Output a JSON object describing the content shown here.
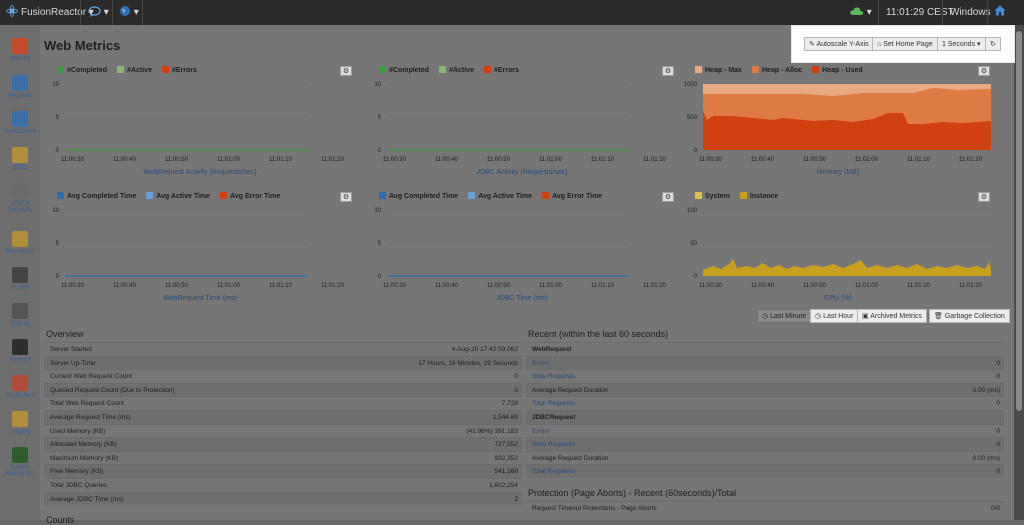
{
  "topbar": {
    "app": "FusionReactor",
    "time": "11:01:29 CEST",
    "os": "Windows"
  },
  "sidebar": [
    {
      "label": "Metrics",
      "icon": "chart-icon",
      "color": "#c64c2c"
    },
    {
      "label": "Requests",
      "icon": "requests-icon",
      "color": "#3d6fa8"
    },
    {
      "label": "Transactions",
      "icon": "transactions-icon",
      "color": "#3d6fa8"
    },
    {
      "label": "JDBC",
      "icon": "database-icon",
      "color": "#b18f3a"
    },
    {
      "label": "UEM & Sessions",
      "icon": "sessions-icon",
      "color": "#6b6b6b"
    },
    {
      "label": "Resources",
      "icon": "resources-icon",
      "color": "#b18f3a"
    },
    {
      "label": "Profiler",
      "icon": "stopwatch-icon",
      "color": "#444444"
    },
    {
      "label": "Debug",
      "icon": "debug-icon",
      "color": "#555555"
    },
    {
      "label": "Memory",
      "icon": "memory-icon",
      "color": "#2e2e2e"
    },
    {
      "label": "Protection",
      "icon": "shield-icon",
      "color": "#b24c3b"
    },
    {
      "label": "Logging",
      "icon": "logging-icon",
      "color": "#b18f3a"
    },
    {
      "label": "System Resources",
      "icon": "system-icon",
      "color": "#2e5d2e"
    }
  ],
  "page": {
    "title": "Web Metrics"
  },
  "toolbar": {
    "autoscale": "Autoscale Y-Axis",
    "home": "Set Home Page",
    "interval": "1 Seconds"
  },
  "charts": [
    {
      "legend": [
        {
          "label": "#Completed",
          "color": "#3f9b3f"
        },
        {
          "label": "#Active",
          "color": "#86b873"
        },
        {
          "label": "#Errors",
          "color": "#d04010"
        }
      ],
      "yticks": [
        "10",
        "5",
        "0"
      ],
      "xticks": [
        "11:00:30",
        "11:00:40",
        "11:00:50",
        "11:01:00",
        "11:01:10",
        "11:01:20"
      ],
      "caption": "WebRequest Activity (Requests/sec)"
    },
    {
      "legend": [
        {
          "label": "#Completed",
          "color": "#3f9b3f"
        },
        {
          "label": "#Active",
          "color": "#86b873"
        },
        {
          "label": "#Errors",
          "color": "#d04010"
        }
      ],
      "yticks": [
        "10",
        "5",
        "0"
      ],
      "xticks": [
        "11:00:30",
        "11:00:40",
        "11:00:50",
        "11:01:00",
        "11:01:10",
        "11:01:20"
      ],
      "caption": "JDBC Activity (Requests/sec)"
    },
    {
      "legend": [
        {
          "label": "Heap - Max",
          "color": "#e8a882"
        },
        {
          "label": "Heap - Alloc",
          "color": "#e07a45"
        },
        {
          "label": "Heap - Used",
          "color": "#d04010"
        }
      ],
      "yticks": [
        "1000",
        "500",
        "0"
      ],
      "xticks": [
        "11:00:30",
        "11:00:40",
        "11:00:50",
        "11:01:00",
        "11:01:10",
        "11:01:20"
      ],
      "caption": "Memory (MB)"
    },
    {
      "legend": [
        {
          "label": "Avg Completed Time",
          "color": "#2c6cb0"
        },
        {
          "label": "Avg Active Time",
          "color": "#6a9fd4"
        },
        {
          "label": "Avg Error Time",
          "color": "#d04010"
        }
      ],
      "yticks": [
        "10",
        "5",
        "0"
      ],
      "xticks": [
        "11:00:30",
        "11:00:40",
        "11:00:50",
        "11:01:00",
        "11:01:10",
        "11:01:20"
      ],
      "caption": "WebRequest Time (ms)"
    },
    {
      "legend": [
        {
          "label": "Avg Completed Time",
          "color": "#2c6cb0"
        },
        {
          "label": "Avg Active Time",
          "color": "#6a9fd4"
        },
        {
          "label": "Avg Error Time",
          "color": "#d04010"
        }
      ],
      "yticks": [
        "10",
        "5",
        "0"
      ],
      "xticks": [
        "11:00:30",
        "11:00:40",
        "11:00:50",
        "11:01:00",
        "11:01:10",
        "11:01:20"
      ],
      "caption": "JDBC Time (ms)"
    },
    {
      "legend": [
        {
          "label": "System",
          "color": "#d8c24a"
        },
        {
          "label": "Instance",
          "color": "#c8a020"
        }
      ],
      "yticks": [
        "100",
        "50",
        "0"
      ],
      "xticks": [
        "11:00:30",
        "11:00:40",
        "11:00:50",
        "11:01:00",
        "11:01:10",
        "11:01:20"
      ],
      "caption": "CPU (%)"
    }
  ],
  "range_buttons": {
    "last_minute": "Last Minute",
    "last_hour": "Last Hour",
    "archived": "Archived Metrics",
    "gc": "Garbage Collection"
  },
  "overview": {
    "title": "Overview",
    "rows": [
      {
        "k": "Server Started",
        "v": "4-Aug-20 17:42:59.062"
      },
      {
        "k": "Server Up-Time",
        "v": "17 Hours, 18 Minutes, 29 Seconds"
      },
      {
        "k": "Current Web Request Count",
        "v": "0"
      },
      {
        "k": "Queued Request Count (Due to Protection)",
        "v": "0"
      },
      {
        "k": "Total Web Request Count",
        "v": "7,728"
      },
      {
        "k": "Average Request Time (ms)",
        "v": "1,544.68"
      },
      {
        "k": "Used Memory (KB)",
        "v": "(41.96%) 391,183"
      },
      {
        "k": "Allocated Memory (KB)",
        "v": "727,552"
      },
      {
        "k": "Maximum Memory (KB)",
        "v": "932,352"
      },
      {
        "k": "Free Memory (KB)",
        "v": "541,168"
      },
      {
        "k": "Total JDBC Queries",
        "v": "1,602,254"
      },
      {
        "k": "Average JDBC Time (ms)",
        "v": "2"
      }
    ],
    "next_title": "Counts"
  },
  "recent": {
    "title": "Recent (within the last 60 seconds)",
    "rows": [
      {
        "k": "WebRequest",
        "v": "",
        "style": "bold"
      },
      {
        "k": "Errors",
        "v": "0",
        "style": "link"
      },
      {
        "k": "Slow Requests",
        "v": "0",
        "style": "link"
      },
      {
        "k": "Average Request Duration",
        "v": "0.00 (ms)",
        "style": ""
      },
      {
        "k": "Total Requests",
        "v": "0",
        "style": "link"
      },
      {
        "k": "JDBCRequest",
        "v": "",
        "style": "bold"
      },
      {
        "k": "Errors",
        "v": "0",
        "style": "link"
      },
      {
        "k": "Slow Requests",
        "v": "0",
        "style": "link"
      },
      {
        "k": "Average Request Duration",
        "v": "0.00 (ms)",
        "style": ""
      },
      {
        "k": "Total Requests",
        "v": "0",
        "style": "link"
      }
    ]
  },
  "protection": {
    "title": "Protection (Page Aborts) - Recent (60seconds)/Total",
    "rows": [
      {
        "k": "Request Timeout Protections - Page Aborts",
        "v": "0/0"
      }
    ]
  }
}
